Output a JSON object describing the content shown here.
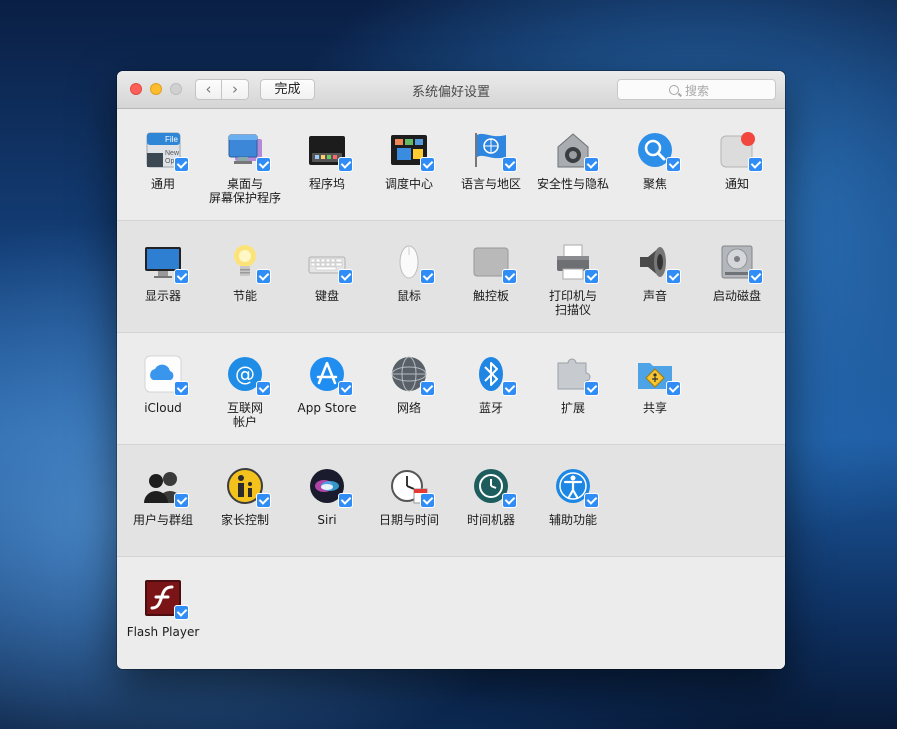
{
  "window": {
    "title": "系统偏好设置",
    "done_label": "完成",
    "back_glyph": "‹",
    "forward_glyph": "›",
    "search_placeholder": "搜索"
  },
  "sections": [
    {
      "items": [
        {
          "label": "通用",
          "icon": "general-icon",
          "checked": true
        },
        {
          "label": "桌面与\n屏幕保护程序",
          "icon": "desktop-screensaver-icon",
          "checked": true
        },
        {
          "label": "程序坞",
          "icon": "dock-icon",
          "checked": true
        },
        {
          "label": "调度中心",
          "icon": "mission-control-icon",
          "checked": true
        },
        {
          "label": "语言与地区",
          "icon": "language-region-icon",
          "checked": true
        },
        {
          "label": "安全性与隐私",
          "icon": "security-privacy-icon",
          "checked": true
        },
        {
          "label": "聚焦",
          "icon": "spotlight-icon",
          "checked": true
        },
        {
          "label": "通知",
          "icon": "notifications-icon",
          "checked": true
        }
      ]
    },
    {
      "items": [
        {
          "label": "显示器",
          "icon": "displays-icon",
          "checked": true
        },
        {
          "label": "节能",
          "icon": "energy-saver-icon",
          "checked": true
        },
        {
          "label": "键盘",
          "icon": "keyboard-icon",
          "checked": true
        },
        {
          "label": "鼠标",
          "icon": "mouse-icon",
          "checked": true
        },
        {
          "label": "触控板",
          "icon": "trackpad-icon",
          "checked": true
        },
        {
          "label": "打印机与\n扫描仪",
          "icon": "printers-scanners-icon",
          "checked": true
        },
        {
          "label": "声音",
          "icon": "sound-icon",
          "checked": true
        },
        {
          "label": "启动磁盘",
          "icon": "startup-disk-icon",
          "checked": true
        }
      ]
    },
    {
      "items": [
        {
          "label": "iCloud",
          "icon": "icloud-icon",
          "checked": true
        },
        {
          "label": "互联网\n帐户",
          "icon": "internet-accounts-icon",
          "checked": true
        },
        {
          "label": "App Store",
          "icon": "app-store-icon",
          "checked": true
        },
        {
          "label": "网络",
          "icon": "network-icon",
          "checked": true
        },
        {
          "label": "蓝牙",
          "icon": "bluetooth-icon",
          "checked": true
        },
        {
          "label": "扩展",
          "icon": "extensions-icon",
          "checked": true
        },
        {
          "label": "共享",
          "icon": "sharing-icon",
          "checked": true
        }
      ]
    },
    {
      "items": [
        {
          "label": "用户与群组",
          "icon": "users-groups-icon",
          "checked": true
        },
        {
          "label": "家长控制",
          "icon": "parental-controls-icon",
          "checked": true
        },
        {
          "label": "Siri",
          "icon": "siri-icon",
          "checked": true
        },
        {
          "label": "日期与时间",
          "icon": "date-time-icon",
          "checked": true
        },
        {
          "label": "时间机器",
          "icon": "time-machine-icon",
          "checked": true
        },
        {
          "label": "辅助功能",
          "icon": "accessibility-icon",
          "checked": true
        }
      ]
    },
    {
      "items": [
        {
          "label": "Flash Player",
          "icon": "flash-player-icon",
          "checked": true
        }
      ]
    }
  ],
  "colors": {
    "checkbox": "#2f8df5",
    "close": "#fc5f57",
    "minimize": "#fdbc2e",
    "zoom_disabled": "#d0d0d0"
  }
}
